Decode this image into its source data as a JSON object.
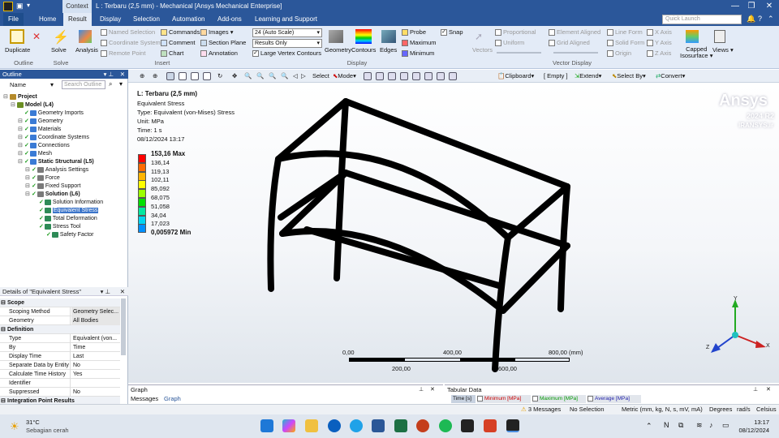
{
  "titlebar": {
    "context_tab": "Context",
    "title": "L : Terbaru (2,5 mm) - Mechanical [Ansys Mechanical Enterprise]",
    "minimize": "—",
    "restore": "❐",
    "close": "✕"
  },
  "tabs": [
    "File",
    "Home",
    "Result",
    "Display",
    "Selection",
    "Automation",
    "Add-ons",
    "Learning and Support"
  ],
  "active_tab": "Result",
  "quick_launch_placeholder": "Quick Launch",
  "ribbon": {
    "duplicate": "Duplicate",
    "solve": "Solve",
    "analysis": "Analysis",
    "named_selection": "Named Selection",
    "coordinate_system": "Coordinate System",
    "remote_point": "Remote Point",
    "commands": "Commands",
    "comment": "Comment",
    "chart": "Chart",
    "images": "Images",
    "section_plane": "Section Plane",
    "annotation": "Annotation",
    "scale_combo": "24 (Auto Scale)",
    "results_combo": "Results Only",
    "large_vertex": "Large Vertex Contours",
    "geometry": "Geometry",
    "contours": "Contours",
    "edges": "Edges",
    "probe": "Probe",
    "maximum": "Maximum",
    "minimum": "Minimum",
    "snap": "Snap",
    "vectors": "Vectors",
    "proportional": "Proportional",
    "uniform": "Uniform",
    "element_aligned": "Element Aligned",
    "grid_aligned": "Grid Aligned",
    "line_form": "Line Form",
    "solid_form": "Solid Form",
    "origin": "Origin",
    "x_axis": "X Axis",
    "y_axis": "Y Axis",
    "z_axis": "Z Axis",
    "capped_isosurface_1": "Capped",
    "capped_isosurface_2": "Isosurface",
    "views": "Views",
    "group_outline": "Outline",
    "group_solve": "Solve",
    "group_insert": "Insert",
    "group_display": "Display",
    "group_vector_display": "Vector Display"
  },
  "toolbar": {
    "select": "Select",
    "mode": "Mode",
    "clipboard": "Clipboard",
    "empty": "[ Empty ]",
    "extend": "Extend",
    "select_by": "Select By",
    "convert": "Convert"
  },
  "outline": {
    "title": "Outline",
    "name_col": "Name",
    "search_placeholder": "Search Outline",
    "items": [
      {
        "label": "Project",
        "level": 0,
        "bold": true
      },
      {
        "label": "Model (L4)",
        "level": 1,
        "bold": true
      },
      {
        "label": "Geometry Imports",
        "level": 2
      },
      {
        "label": "Geometry",
        "level": 2
      },
      {
        "label": "Materials",
        "level": 2
      },
      {
        "label": "Coordinate Systems",
        "level": 2
      },
      {
        "label": "Connections",
        "level": 2
      },
      {
        "label": "Mesh",
        "level": 2
      },
      {
        "label": "Static Structural (L5)",
        "level": 2,
        "bold": true
      },
      {
        "label": "Analysis Settings",
        "level": 3
      },
      {
        "label": "Force",
        "level": 3
      },
      {
        "label": "Fixed Support",
        "level": 3
      },
      {
        "label": "Solution (L6)",
        "level": 3,
        "bold": true
      },
      {
        "label": "Solution Information",
        "level": 4
      },
      {
        "label": "Equivalent Stress",
        "level": 4,
        "selected": true
      },
      {
        "label": "Total Deformation",
        "level": 4
      },
      {
        "label": "Stress Tool",
        "level": 4
      },
      {
        "label": "Safety Factor",
        "level": 5
      }
    ]
  },
  "details": {
    "title": "Details of \"Equivalent Stress\"",
    "rows": [
      {
        "k": "Scope",
        "v": "",
        "section": true
      },
      {
        "k": "Scoping Method",
        "v": "Geometry Selec..."
      },
      {
        "k": "Geometry",
        "v": "All Bodies"
      },
      {
        "k": "Definition",
        "v": "",
        "section": true
      },
      {
        "k": "Type",
        "v": "Equivalent (von..."
      },
      {
        "k": "By",
        "v": "Time"
      },
      {
        "k": "Display Time",
        "v": "Last"
      },
      {
        "k": "Separate Data by Entity",
        "v": "No"
      },
      {
        "k": "Calculate Time History",
        "v": "Yes"
      },
      {
        "k": "Identifier",
        "v": ""
      },
      {
        "k": "Suppressed",
        "v": "No"
      },
      {
        "k": "Integration Point Results",
        "v": "",
        "section": true
      }
    ]
  },
  "viewport": {
    "result_title": "L: Terbaru (2,5 mm)",
    "line2": "Equivalent Stress",
    "line3": "Type: Equivalent (von-Mises) Stress",
    "line4": "Unit: MPa",
    "line5": "Time: 1 s",
    "line6": "08/12/2024 13:17",
    "legend": [
      "153,16 Max",
      "136,14",
      "119,13",
      "102,11",
      "85,092",
      "68,075",
      "51,058",
      "34,04",
      "17,023",
      "0,005972 Min"
    ],
    "legend_colors": [
      "#ff0000",
      "#ff6a00",
      "#ffb400",
      "#ffff00",
      "#9bff00",
      "#00e000",
      "#00e8a0",
      "#00d6f0",
      "#0090ff",
      "#0000ff"
    ],
    "brand": "Ansys",
    "brand_version": "2024 R2",
    "brand_site": "IRANSYS.ir",
    "scale_top": [
      "0,00",
      "400,00",
      "800,00 (mm)"
    ],
    "scale_bottom": [
      "200,00",
      "600,00"
    ],
    "axis_x": "X",
    "axis_y": "Y",
    "axis_z": "Z"
  },
  "graph_panel": {
    "title": "Graph",
    "tab_messages": "Messages",
    "tab_graph": "Graph"
  },
  "tabular_panel": {
    "title": "Tabular Data",
    "col_time": "Time [s]",
    "col_min": "Minimum [MPa]",
    "col_max": "Maximum [MPa]",
    "col_avg": "Average [MPa]"
  },
  "statusbar": {
    "messages": "3 Messages",
    "selection": "No Selection",
    "units": "Metric (mm, kg, N, s, mV, mA)",
    "degrees": "Degrees",
    "rads": "rad/s",
    "celsius": "Celsius"
  },
  "taskbar": {
    "temperature": "31°C",
    "weather": "Sebagian cerah",
    "time": "13:17",
    "date": "08/12/2024"
  }
}
